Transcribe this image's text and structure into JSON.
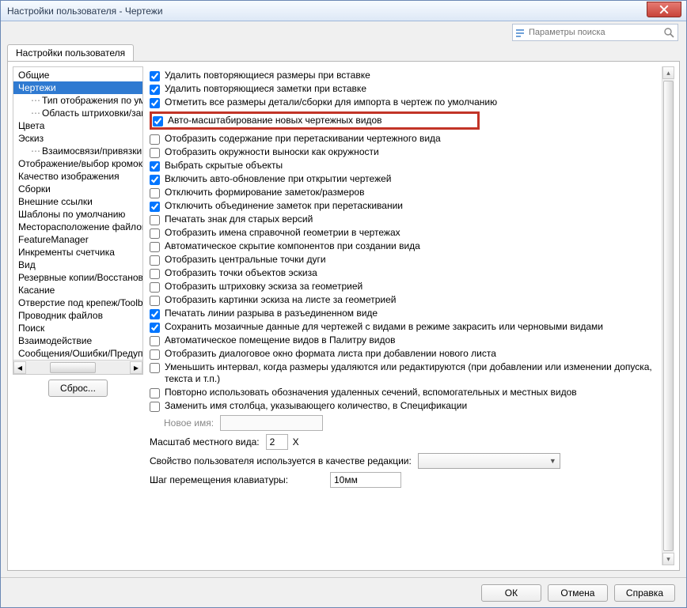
{
  "window": {
    "title": "Настройки пользователя - Чертежи"
  },
  "search": {
    "placeholder": "Параметры поиска"
  },
  "tab": {
    "label": "Настройки пользователя"
  },
  "sidebar": {
    "items": [
      "Общие",
      "Чертежи",
      "Тип отображения по умолчанию",
      "Область штриховки/заполнения",
      "Цвета",
      "Эскиз",
      "Взаимосвязи/привязки",
      "Отображение/выбор кромок",
      "Качество изображения",
      "Сборки",
      "Внешние ссылки",
      "Шаблоны по умолчанию",
      "Месторасположение файлов",
      "FeatureManager",
      "Инкременты счетчика",
      "Вид",
      "Резервные копии/Восстановление",
      "Касание",
      "Отверстие под крепеж/Toolbox",
      "Проводник файлов",
      "Поиск",
      "Взаимодействие",
      "Сообщения/Ошибки/Предупреждения"
    ],
    "reset": "Сброс..."
  },
  "options": [
    {
      "checked": true,
      "label": "Удалить повторяющиеся размеры при вставке"
    },
    {
      "checked": true,
      "label": "Удалить повторяющиеся заметки при вставке"
    },
    {
      "checked": true,
      "label": "Отметить все размеры детали/сборки для импорта в чертеж по умолчанию"
    },
    {
      "checked": true,
      "label": "Авто-масштабирование новых чертежных видов",
      "highlight": true
    },
    {
      "checked": false,
      "label": "Отобразить содержание при перетаскивании чертежного вида"
    },
    {
      "checked": false,
      "label": "Отобразить окружности выноски как окружности"
    },
    {
      "checked": true,
      "label": "Выбрать скрытые объекты"
    },
    {
      "checked": true,
      "label": "Включить авто-обновление при открытии чертежей"
    },
    {
      "checked": false,
      "label": "Отключить формирование заметок/размеров"
    },
    {
      "checked": true,
      "label": "Отключить объединение заметок при перетаскивании"
    },
    {
      "checked": false,
      "label": "Печатать знак для старых версий"
    },
    {
      "checked": false,
      "label": "Отобразить имена справочной геометрии в чертежах"
    },
    {
      "checked": false,
      "label": "Автоматическое скрытие компонентов при создании вида"
    },
    {
      "checked": false,
      "label": "Отобразить центральные точки дуги"
    },
    {
      "checked": false,
      "label": "Отобразить точки объектов эскиза"
    },
    {
      "checked": false,
      "label": "Отобразить штриховку эскиза за геометрией"
    },
    {
      "checked": false,
      "label": "Отобразить картинки эскиза на листе за геометрией"
    },
    {
      "checked": true,
      "label": "Печатать линии разрыва в разъединенном виде"
    },
    {
      "checked": true,
      "label": "Сохранить мозаичные данные для чертежей с видами в режиме закрасить или черновыми видами"
    },
    {
      "checked": false,
      "label": "Автоматическое помещение видов в Палитру видов"
    },
    {
      "checked": false,
      "label": "Отобразить диалоговое окно формата листа при добавлении нового листа"
    },
    {
      "checked": false,
      "label": "Уменьшить интервал, когда размеры удаляются или редактируются (при добавлении или изменении допуска, текста и т.п.)"
    },
    {
      "checked": false,
      "label": "Повторно использовать обозначения удаленных сечений, вспомогательных и местных видов"
    },
    {
      "checked": false,
      "label": "Заменить имя столбца, указывающего количество, в Спецификации"
    }
  ],
  "form": {
    "newname_label": "Новое имя:",
    "scale_label": "Масштаб местного вида:",
    "scale_value": "2",
    "scale_suffix": "X",
    "custprop_label": "Свойство пользователя используется в качестве редакции:",
    "step_label": "Шаг перемещения клавиатуры:",
    "step_value": "10мм"
  },
  "footer": {
    "ok": "ОК",
    "cancel": "Отмена",
    "help": "Справка"
  }
}
